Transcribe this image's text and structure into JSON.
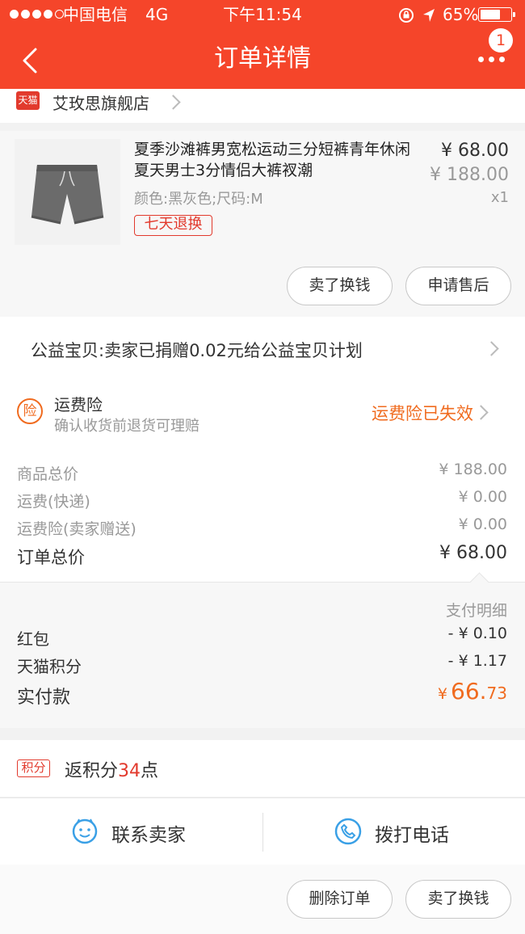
{
  "status_bar": {
    "carrier": "中国电信",
    "network": "4G",
    "time": "下午11:54",
    "battery": "65%"
  },
  "nav": {
    "title": "订单详情",
    "badge": "1"
  },
  "shop": {
    "badge": "天猫",
    "name": "艾玫思旗舰店"
  },
  "product": {
    "title": "夏季沙滩裤男宽松运动三分短裤青年休闲夏天男士3分情侣大裤衩潮",
    "price": "¥ 68.00",
    "original_price": "¥ 188.00",
    "quantity": "x1",
    "sku": "颜色:黑灰色;尺码:M",
    "tag": "七天退换",
    "sell_button": "卖了换钱",
    "after_sale_button": "申请售后"
  },
  "charity": {
    "text": "公益宝贝:卖家已捐赠0.02元给公益宝贝计划"
  },
  "insurance": {
    "icon_text": "险",
    "title": "运费险",
    "subtitle": "确认收货前退货可理赔",
    "status": "运费险已失效"
  },
  "summary": {
    "rows": [
      {
        "label": "商品总价",
        "value": "¥ 188.00"
      },
      {
        "label": "运费(快递)",
        "value": "¥ 0.00"
      },
      {
        "label": "运费险(卖家赠送)",
        "value": "¥ 0.00"
      }
    ],
    "total_label": "订单总价",
    "total_value": "¥ 68.00"
  },
  "payment": {
    "detail_label": "支付明细",
    "rows": [
      {
        "label": "红包",
        "value": "- ¥ 0.10"
      },
      {
        "label": "天猫积分",
        "value": "- ¥ 1.17"
      }
    ],
    "paid_label": "实付款",
    "paid_currency": "¥",
    "paid_int": "66.",
    "paid_dec": "73"
  },
  "points": {
    "badge": "积分",
    "prefix": "返积分",
    "value": "34",
    "suffix": "点"
  },
  "contact": {
    "seller": "联系卖家",
    "phone": "拨打电话"
  },
  "bottom": {
    "delete": "删除订单",
    "sell": "卖了换钱"
  },
  "colors": {
    "brand": "#f5452a",
    "accent_orange": "#f06b1f",
    "tmall_red": "#e23a2d",
    "blue": "#3aa0e6"
  }
}
